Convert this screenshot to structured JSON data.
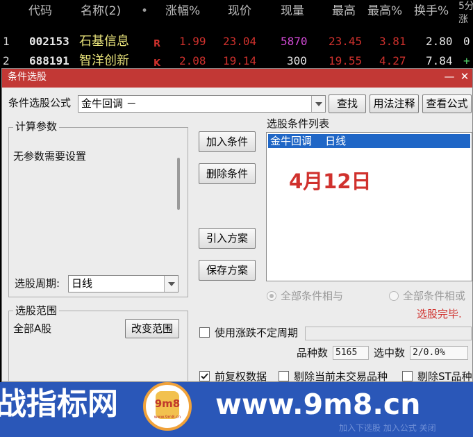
{
  "table": {
    "headers": [
      "代码",
      "名称(2)",
      "•",
      "涨幅%",
      "现价",
      "现量",
      "最高",
      "最高%",
      "换手%",
      "5分",
      "涨"
    ],
    "rows": [
      {
        "index": "1",
        "code": "002153",
        "name": "石基信息",
        "flag": "R",
        "change": "1.99",
        "price": "23.04",
        "volume": "5870",
        "high": "23.45",
        "high_pct": "3.81",
        "turnover": "2.80",
        "fivemin": "0"
      },
      {
        "index": "2",
        "code": "688191",
        "name": "智洋创新",
        "flag": "K",
        "change": "2.08",
        "price": "19.14",
        "volume": "300",
        "high": "19.55",
        "high_pct": "4.27",
        "turnover": "7.84",
        "fivemin": "+"
      }
    ]
  },
  "dialog": {
    "title": "条件选股",
    "minimize": "—",
    "close": "✕",
    "formula_label": "条件选股公式",
    "formula_value": "金牛回调  －",
    "find_button": "查找",
    "usage_button": "用法注释",
    "view_formula_button": "查看公式",
    "params_group": "计算参数",
    "params_text": "无参数需要设置",
    "period_label": "选股周期:",
    "period_value": "日线",
    "add_condition": "加入条件",
    "delete_condition": "删除条件",
    "import_plan": "引入方案",
    "save_plan": "保存方案",
    "list_title": "选股条件列表",
    "list_items": [
      "金牛回调    日线"
    ],
    "annotation": "4月12日",
    "radio_and": "全部条件相与",
    "radio_or": "全部条件相或",
    "status": "选股完毕.",
    "range_group": "选股范围",
    "range_value": "全部A股",
    "change_range": "改变范围",
    "use_period_label": "使用涨跌不定周期",
    "count_label": "品种数",
    "count_value": "5165",
    "selected_label": "选中数",
    "selected_value": "2/0.0%",
    "prior_adjust": "前复权数据",
    "exclude_untraded": "剔除当前未交易品种",
    "exclude_st": "剔除ST品种"
  },
  "banner": {
    "left_text": "战指标网",
    "logo_text": "9m8",
    "logo_sub": "www.9m8.cn",
    "url_text": "www.9m8.cn",
    "faint_text": "加入下选股   加入公式  关闭"
  },
  "colors": {
    "red": "#d0312d",
    "yellow": "#e8e27a",
    "green": "#54d36b",
    "magenta": "#d24ad6",
    "dialog_bg": "#ececec",
    "titlebar": "#c23835",
    "banner": "#2a57b8",
    "selection": "#1f66c6"
  }
}
